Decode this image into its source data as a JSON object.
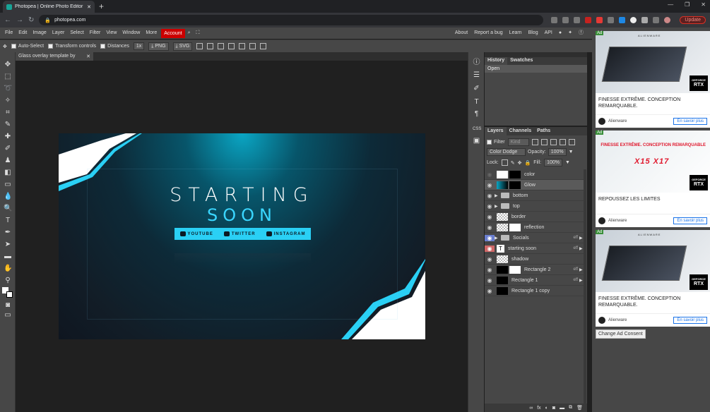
{
  "browser": {
    "tab_title": "Photopea | Online Photo Editor",
    "new_tab": "+",
    "url": "photopea.com",
    "update_label": "Update",
    "window_controls": [
      "—",
      "❐",
      "✕"
    ]
  },
  "menu": {
    "items": [
      "File",
      "Edit",
      "Image",
      "Layer",
      "Select",
      "Filter",
      "View",
      "Window",
      "More"
    ],
    "account": "Account",
    "right": [
      "About",
      "Report a bug",
      "Learn",
      "Blog",
      "API"
    ]
  },
  "options": {
    "auto_select": "Auto-Select",
    "transform_controls": "Transform controls",
    "distances": "Distances",
    "scale": "1x",
    "png": "PNG",
    "svg": "SVG"
  },
  "document": {
    "tab_title": "Glass overlay template by",
    "close": "✕",
    "canvas": {
      "title_line1": "STARTING",
      "title_line2": "SOON",
      "socials": [
        "YOUTUBE",
        "TWITTER",
        "INSTAGRAM"
      ]
    }
  },
  "history": {
    "tab": "History",
    "tab2": "Swatches",
    "entries": [
      "Open"
    ]
  },
  "layers": {
    "tabs": [
      "Layers",
      "Channels",
      "Paths"
    ],
    "filter": "Filter",
    "kind": "Kind",
    "blend": "Color Dodge",
    "opacity_label": "Opacity:",
    "opacity": "100%",
    "lock_label": "Lock:",
    "fill_label": "Fill:",
    "fill": "100%",
    "items": [
      {
        "name": "color",
        "fx": ""
      },
      {
        "name": "Glow",
        "fx": ""
      },
      {
        "name": "bottom",
        "fx": ""
      },
      {
        "name": "top",
        "fx": ""
      },
      {
        "name": "border",
        "fx": ""
      },
      {
        "name": "reflection",
        "fx": ""
      },
      {
        "name": "Socials",
        "fx": "eff"
      },
      {
        "name": "starting soon",
        "fx": "eff"
      },
      {
        "name": "shadow",
        "fx": ""
      },
      {
        "name": "Rectangle 2",
        "fx": "eff"
      },
      {
        "name": "Rectangle 1",
        "fx": "eff"
      },
      {
        "name": "Rectangle 1 copy",
        "fx": ""
      }
    ]
  },
  "ads": [
    {
      "tag": "Ad",
      "brand": "ALIENWARE",
      "rtx": "RTX",
      "rtx_small": "GEFORCE",
      "text": "FINESSE EXTRÊME. CONCEPTION REMARQUABLE.",
      "advertiser": "Alienware",
      "cta": "En savoir plus"
    },
    {
      "tag": "Ad",
      "headline": "FINESSE EXTRÊME. CONCEPTION REMARQUABLE",
      "models": "X15  X17",
      "rtx": "RTX",
      "rtx_small": "GEFORCE",
      "text": "REPOUSSEZ LES LIMITES",
      "advertiser": "Alienware",
      "cta": "En savoir plus"
    },
    {
      "tag": "Ad",
      "brand": "ALIENWARE",
      "rtx": "RTX",
      "rtx_small": "GEFORCE",
      "text": "FINESSE EXTRÊME. CONCEPTION REMARQUABLE.",
      "advertiser": "Alienware",
      "cta": "En savoir plus"
    }
  ],
  "consent": "Change Ad Consent",
  "colors": {
    "accent_cyan": "#2ad0f5",
    "account_red": "#cc0000",
    "panel": "#474747"
  }
}
